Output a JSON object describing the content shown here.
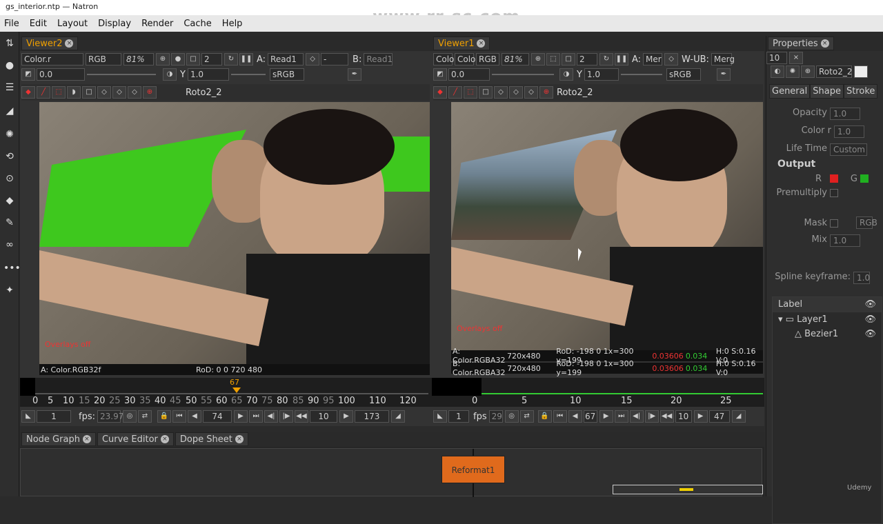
{
  "window": {
    "title": "gs_interior.ntp — Natron"
  },
  "watermark": "www.rr-sc.com",
  "menu": [
    "File",
    "Edit",
    "Layout",
    "Display",
    "Render",
    "Cache",
    "Help"
  ],
  "left_tools": [
    "roto-select-icon",
    "bezier-icon",
    "blur-icon",
    "smear-icon",
    "clone-icon",
    "dodge-icon",
    "bucket-icon",
    "eraser-icon",
    "loop-icon",
    "dots-icon",
    "star-icon"
  ],
  "viewer2": {
    "tab": "Viewer2",
    "layer": "Color.r",
    "channels": "RGB",
    "zoom": "81%",
    "proxy": "2",
    "input_a_label": "A:",
    "input_a": "Read1",
    "input_b_label": "B:",
    "input_b": "Read1",
    "gain": "0.0",
    "gamma": "1.0",
    "colorspace": "sRGB",
    "roto_node": "Roto2_2",
    "overlay": "Overlays off",
    "info_left": "A: Color.RGB32f",
    "info_right": "RoD: 0 0 720 480",
    "timeline_marker": "67",
    "ticks": [
      "0",
      "5",
      "10",
      "15",
      "20",
      "25",
      "30",
      "35",
      "40",
      "45",
      "50",
      "55",
      "60",
      "65",
      "70",
      "75",
      "80",
      "85",
      "90",
      "95",
      "100",
      "110",
      "120"
    ],
    "start_frame": "1",
    "fps_label": "fps:",
    "fps": "23.97",
    "current_frame": "74",
    "increment": "10",
    "end_frame": "173"
  },
  "viewer1": {
    "tab": "Viewer1",
    "layer": "Colo",
    "alpha": "Colo",
    "channels": "RGB",
    "zoom": "81%",
    "proxy": "2",
    "input_a_label": "A:",
    "input_a": "Mer",
    "input_b_label": "W-UB:",
    "input_b": "Merg",
    "gain": "0.0",
    "gamma": "1.0",
    "colorspace": "sRGB",
    "roto_node": "Roto2_2",
    "overlay": "Overlays off",
    "info_a": {
      "label": "A: Color.RGBA32",
      "res": "720x480",
      "rod": "RoD: -198 0 1x=300 y=199",
      "v1": "0.03606",
      "v2": "0.034",
      "hsv": "H:0 S:0.16 V:0"
    },
    "info_b": {
      "label": "B: Color.RGBA32",
      "res": "720x480",
      "rod": "RoD: -198 0 1x=300 y=199",
      "v1": "0.03606",
      "v2": "0.034",
      "hsv": "H:0 S:0.16 V:0"
    },
    "ticks": [
      "0",
      "5",
      "10",
      "15",
      "20",
      "25"
    ],
    "start_frame": "1",
    "fps_label": "fps",
    "fps": "29",
    "current_frame": "67",
    "increment": "10",
    "end_frame": "47"
  },
  "bottom_tabs": [
    "Node Graph",
    "Curve Editor",
    "Dope Sheet"
  ],
  "node_label": "Reformat1",
  "properties": {
    "tab": "Properties",
    "count": "10",
    "node_name": "Roto2_2",
    "sub_tabs": [
      "General",
      "Shape",
      "Stroke"
    ],
    "opacity_label": "Opacity",
    "opacity": "1.0",
    "color_label": "Color r",
    "color": "1.0",
    "lifetime_label": "Life Time",
    "lifetime": "Custom",
    "output_label": "Output",
    "r_label": "R",
    "g_label": "G",
    "premult_label": "Premultiply",
    "mask_label": "Mask",
    "mask_value": "RGB",
    "mix_label": "Mix",
    "mix": "1.0",
    "spline_label": "Spline keyframe:",
    "spline": "1.0",
    "label_header": "Label",
    "layer1": "Layer1",
    "bezier1": "Bezier1"
  },
  "colors": {
    "accent": "#f0a000",
    "green_screen": "#3ec81e",
    "overlay_red": "#e02020"
  },
  "branding": "Udemy"
}
